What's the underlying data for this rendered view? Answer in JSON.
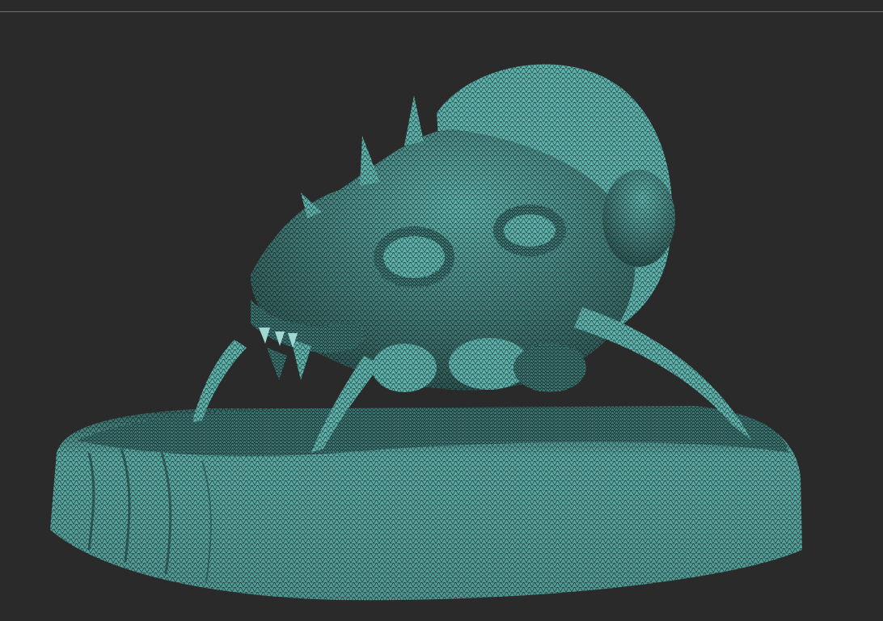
{
  "viewport": {
    "background_color": "#2a2a2a",
    "separator_color": "#6e6e6e"
  },
  "model": {
    "display_mode": "wireframe",
    "mesh_color": "#5fb3ad",
    "mesh_shadow_color": "#1f3f3d",
    "wire_color": "#1a2f2e"
  }
}
